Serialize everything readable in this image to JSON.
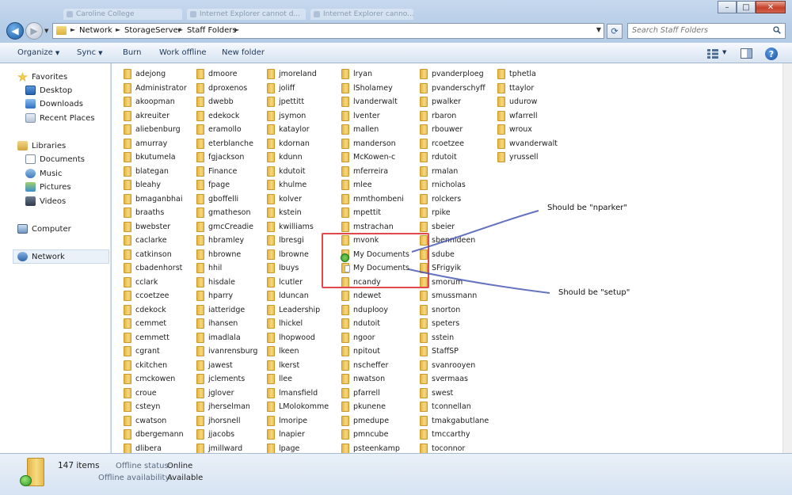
{
  "title_strip": {
    "ghost_tabs": [
      "Caroline College",
      "Internet Explorer cannot d...",
      "Internet Explorer canno..."
    ]
  },
  "window_controls": {
    "minimize": "–",
    "maximize": "□",
    "close": "✕"
  },
  "address_bar": {
    "breadcrumbs": [
      "Network",
      "StorageServer",
      "Staff Folders"
    ],
    "separator": "►"
  },
  "search": {
    "placeholder": "Search Staff Folders"
  },
  "toolbar": {
    "organize": "Organize",
    "sync": "Sync",
    "burn": "Burn",
    "work_offline": "Work offline",
    "new_folder": "New folder"
  },
  "nav_pane": {
    "favorites": {
      "label": "Favorites",
      "items": [
        "Desktop",
        "Downloads",
        "Recent Places"
      ]
    },
    "libraries": {
      "label": "Libraries",
      "items": [
        "Documents",
        "Music",
        "Pictures",
        "Videos"
      ]
    },
    "computer": "Computer",
    "network": "Network"
  },
  "folders": {
    "columns": [
      [
        "adejong",
        "Administrator",
        "akoopman",
        "akreuiter",
        "aliebenburg",
        "amurray",
        "bkutumela",
        "blategan",
        "bleahy",
        "bmaganbhai",
        "braaths",
        "bwebster",
        "caclarke",
        "catkinson",
        "cbadenhorst",
        "cclark",
        "ccoetzee",
        "cdekock",
        "cemmet",
        "cemmett",
        "cgrant",
        "ckitchen",
        "cmckowen",
        "croue",
        "csteyn",
        "cwatson",
        "dbergemann",
        "dlibera"
      ],
      [
        "dmoore",
        "dproxenos",
        "dwebb",
        "edekock",
        "eramollo",
        "eterblanche",
        "fgjackson",
        "Finance",
        "fpage",
        "gboffelli",
        "gmatheson",
        "gmcCreadie",
        "hbramley",
        "hbrowne",
        "hhil",
        "hisdale",
        "hparry",
        "iatteridge",
        "ihansen",
        "imadlala",
        "ivanrensburg",
        "jawest",
        "jclements",
        "jglover",
        "jherselman",
        "jhorsnell",
        "jjacobs",
        "jmillward"
      ],
      [
        "jmoreland",
        "joliff",
        "jpettitt",
        "jsymon",
        "kataylor",
        "kdornan",
        "kdunn",
        "kdutoit",
        "khulme",
        "kolver",
        "kstein",
        "kwilliams",
        "lbresgi",
        "lbrowne",
        "lbuys",
        "lcutler",
        "lduncan",
        "Leadership",
        "lhickel",
        "lhopwood",
        "lkeen",
        "lkerst",
        "llee",
        "lmansfield",
        "LMolokomme",
        "lmoripe",
        "lnapier",
        "lpage"
      ],
      [
        "lryan",
        "lSholamey",
        "lvanderwalt",
        "lventer",
        "mallen",
        "manderson",
        "McKowen-c",
        "mferreira",
        "mlee",
        "mmthombeni",
        "mpettit",
        "mstrachan",
        "mvonk",
        "My Documents",
        "My Documents",
        "ncandy",
        "ndewet",
        "nduplooy",
        "ndutoit",
        "ngoor",
        "npitout",
        "nscheffer",
        "nwatson",
        "pfarrell",
        "pkunene",
        "pmedupe",
        "pmncube",
        "psteenkamp"
      ],
      [
        "pvanderploeg",
        "pvanderschyff",
        "pwalker",
        "rbaron",
        "rbouwer",
        "rcoetzee",
        "rdutoit",
        "rmalan",
        "rnicholas",
        "rolckers",
        "rpike",
        "sbeier",
        "sbennideen",
        "sdube",
        "SFrigyik",
        "smorum",
        "smussmann",
        "snorton",
        "speters",
        "sstein",
        "StaffSP",
        "svanrooyen",
        "svermaas",
        "swest",
        "tconnellan",
        "tmakgabutlane",
        "tmccarthy",
        "toconnor"
      ],
      [
        "tphetla",
        "ttaylor",
        "udurow",
        "wfarrell",
        "wroux",
        "wvanderwalt",
        "yrussell"
      ]
    ]
  },
  "annotations": {
    "note_top": "Should be \"nparker\"",
    "note_bottom": "Should be \"setup\"",
    "highlight_color": "#e0484c",
    "arrow_color": "#3d4fb0"
  },
  "status_bar": {
    "item_count": "147 items",
    "offline_status_label": "Offline status:",
    "offline_status_value": "Online",
    "offline_availability_label": "Offline availability:",
    "offline_availability_value": "Available"
  }
}
